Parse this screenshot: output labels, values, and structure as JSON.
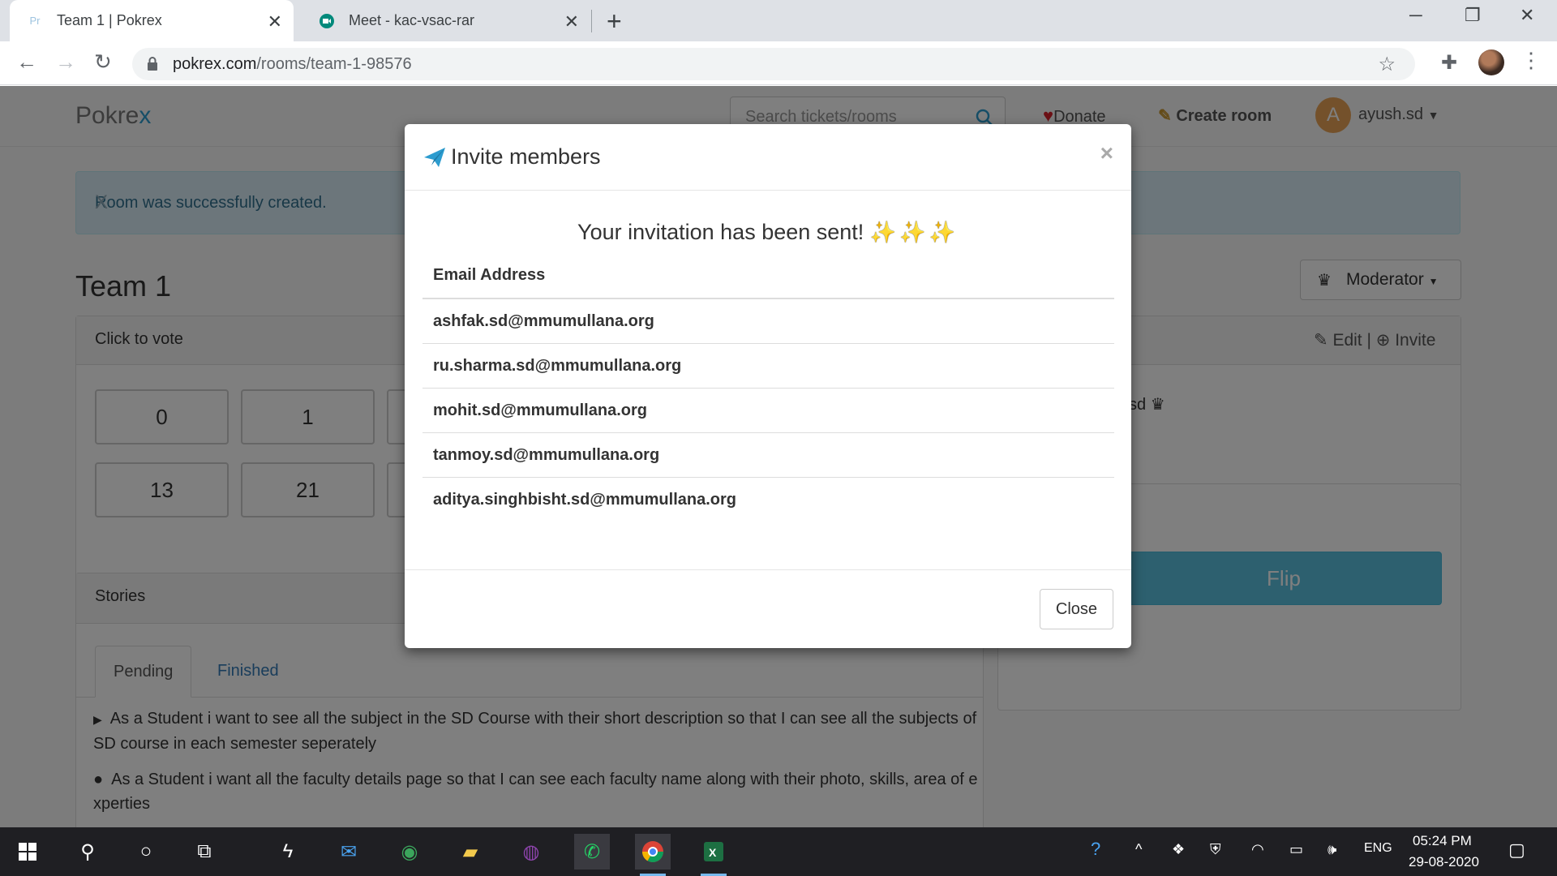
{
  "browser": {
    "tabs": [
      {
        "title": "Team 1 | Pokrex",
        "favicon": "Pr",
        "active": true
      },
      {
        "title": "Meet - kac-vsac-rar",
        "favicon": "meet-icon",
        "active": false
      }
    ],
    "url_domain": "pokrex.com",
    "url_path": "/rooms/team-1-98576"
  },
  "navbar": {
    "brand_main": "Pokre",
    "brand_x": "x",
    "search_placeholder": "Search tickets/rooms",
    "donate": "Donate",
    "create_room": "Create room",
    "avatar_letter": "A",
    "username": "ayush.sd"
  },
  "alert": {
    "message": "Room was successfully created.",
    "close": "X"
  },
  "room": {
    "title": "Team 1",
    "role": "Moderator",
    "vote_header": "Click to vote",
    "cards": [
      "0",
      "1",
      "13",
      "21"
    ],
    "edit": "Edit",
    "invite": "Invite",
    "member_suffix": "sd",
    "flip": "Flip",
    "stories_header": "Stories",
    "tab_pending": "Pending",
    "tab_finished": "Finished",
    "stories": [
      "As a Student i want to see all the subject in the SD Course with their short description so that I can see all the subjects of SD course in each semester seperately",
      "As a Student i want all the faculty details page so that I can see each faculty name along with their photo, skills, area of experties"
    ]
  },
  "modal": {
    "title": "Invite members",
    "message": "Your invitation has been sent!",
    "sparkles": "✨✨✨",
    "column_header": "Email Address",
    "emails": [
      "ashfak.sd@mmumullana.org",
      "ru.sharma.sd@mmumullana.org",
      "mohit.sd@mmumullana.org",
      "tanmoy.sd@mmumullana.org",
      "aditya.singhbisht.sd@mmumullana.org"
    ],
    "close": "Close"
  },
  "taskbar": {
    "language": "ENG",
    "time": "05:24 PM",
    "date": "29-08-2020"
  },
  "colors": {
    "accent": "#2c9ccf",
    "flip": "#5bc0de",
    "alert_bg": "#d9edf7",
    "alert_text": "#31708f"
  }
}
